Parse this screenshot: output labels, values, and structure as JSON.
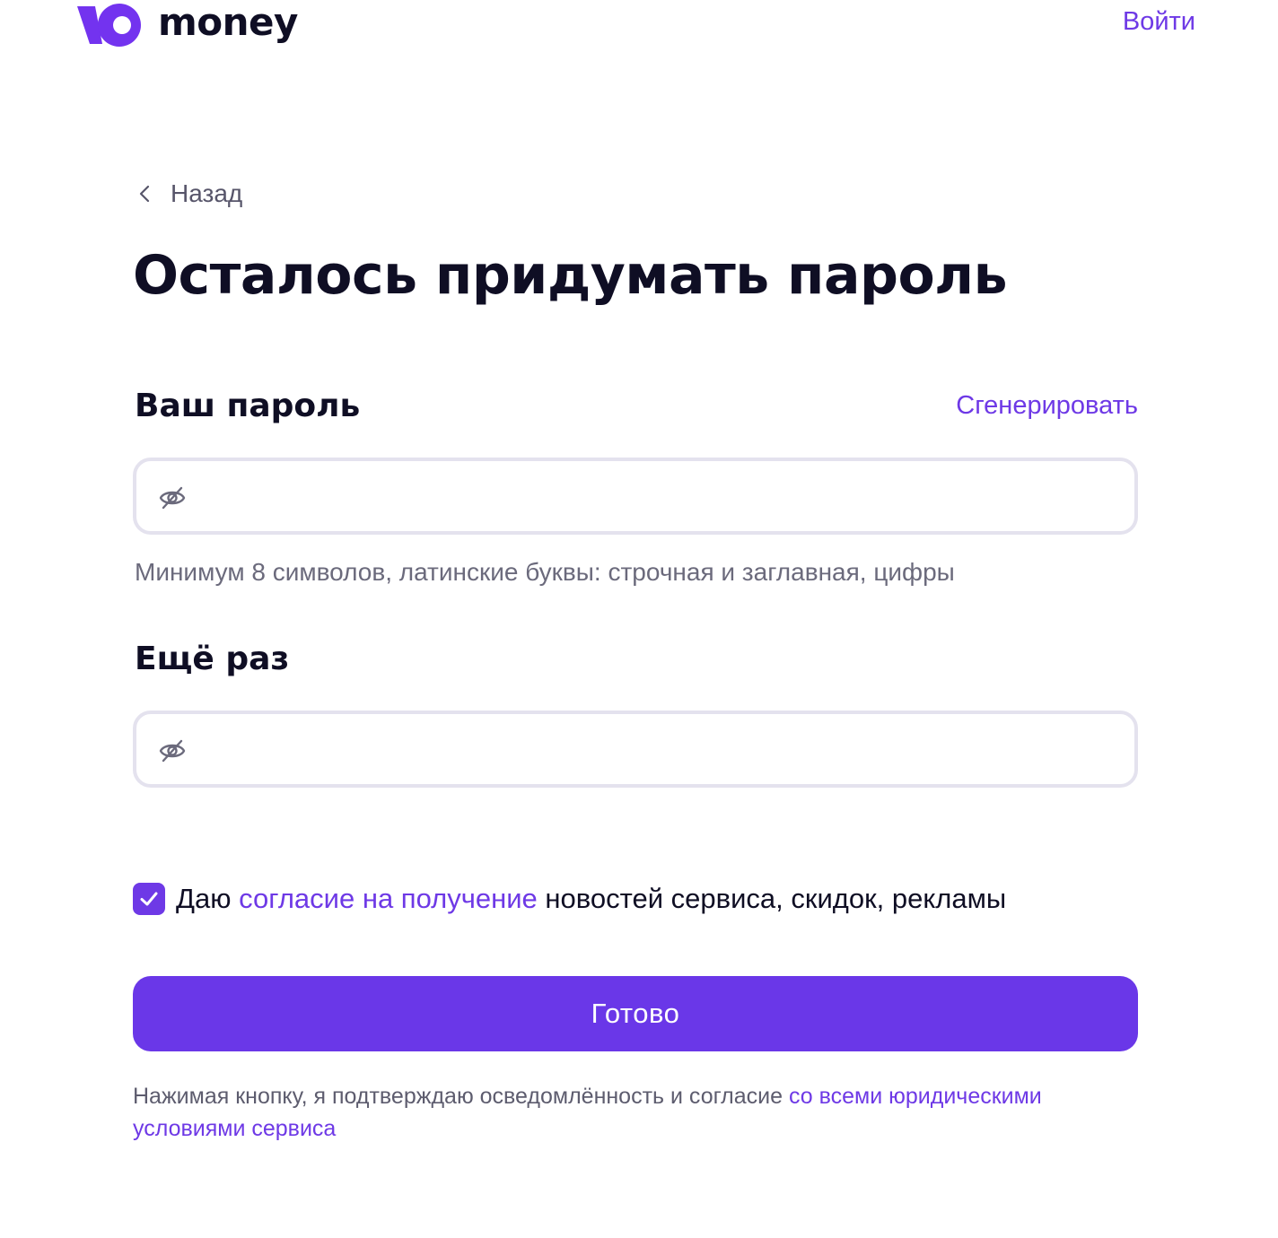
{
  "header": {
    "logo_text": "money",
    "login_label": "Войти"
  },
  "nav": {
    "back_label": "Назад"
  },
  "title": "Осталось придумать пароль",
  "password": {
    "label": "Ваш пароль",
    "generate_label": "Сгенерировать",
    "value": "",
    "placeholder": "",
    "hint": "Минимум 8 символов, латинские буквы: строчная и заглавная, цифры"
  },
  "confirm": {
    "label": "Ещё раз",
    "value": "",
    "placeholder": ""
  },
  "consent": {
    "checked": true,
    "prefix": "Даю ",
    "link": "согласие на получение",
    "suffix": " новостей сервиса, скидок, рекламы"
  },
  "submit_label": "Готово",
  "legal": {
    "text": "Нажимая кнопку, я подтверждаю осведомлённость и согласие ",
    "link": "со всеми юридическими условиями сервиса"
  },
  "colors": {
    "accent": "#6e39e6",
    "button": "#6a37e8",
    "input_border": "#e4e2ee",
    "text": "#0f0e24",
    "muted": "#6b6a7c"
  },
  "icons": {
    "logo": "yoomoney-logo-icon",
    "back": "chevron-left-icon",
    "password_toggle": "eye-off-icon",
    "checkbox": "checkmark-icon"
  }
}
